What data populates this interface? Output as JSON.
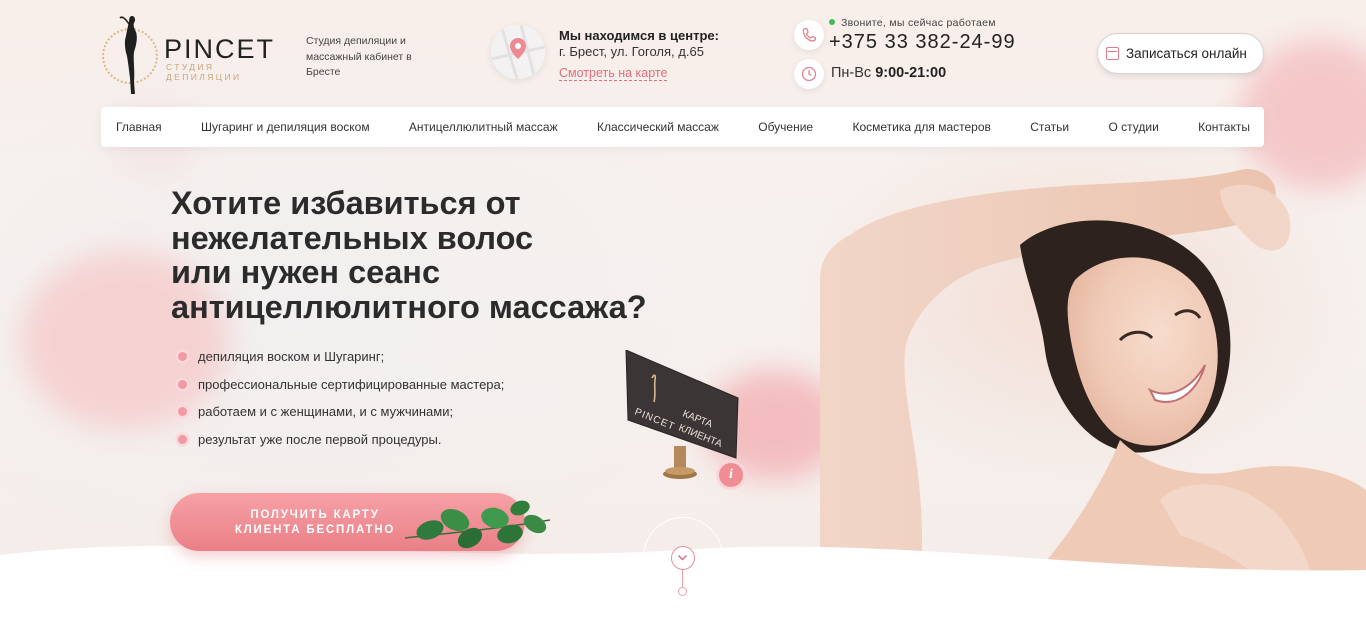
{
  "brand": {
    "name": "PINCET",
    "subtitle": "СТУДИЯ ДЕПИЛЯЦИИ",
    "tagline": "Студия депиляции и массажный кабинет в Бресте"
  },
  "location": {
    "title": "Мы находимся в центре:",
    "address": "г. Брест, ул. Гоголя, д.65",
    "map_link": "Смотреть на карте"
  },
  "contact": {
    "status": "Звоните, мы сейчас работаем",
    "phone": "+375 33 382-24-99",
    "hours_days": "Пн-Вс",
    "hours_time": "9:00-21:00"
  },
  "book_button": "Записаться онлайн",
  "nav": [
    "Главная",
    "Шугаринг и депиляция воском",
    "Антицеллюлитный массаж",
    "Классический массаж",
    "Обучение",
    "Косметика для мастеров",
    "Статьи",
    "О студии",
    "Контакты"
  ],
  "hero": {
    "line1": "Хотите избавиться от",
    "line2": "нежелательных волос",
    "line3": "или нужен сеанс",
    "line4": "антицеллюлитного массажа?",
    "bullets": [
      "депиляция воском и Шугаринг;",
      "профессиональные сертифицированные мастера;",
      "работаем и с женщинами, и с мужчинами;",
      "результат уже после первой процедуры."
    ],
    "cta": "ПОЛУЧИТЬ КАРТУ КЛИЕНТА БЕСПЛАТНО"
  },
  "client_card": {
    "brand": "PINCET",
    "text_line1": "КАРТА",
    "text_line2": "КЛИЕНТА",
    "info": "i"
  },
  "colors": {
    "accent": "#ea7f86",
    "accent_light": "#f6a1a6",
    "gold": "#c9a57a",
    "status_green": "#3cbf5a"
  },
  "icons": {
    "location": "map-pin-icon",
    "phone": "phone-icon",
    "clock": "clock-icon",
    "calendar": "calendar-icon",
    "scroll": "chevron-down-icon"
  }
}
